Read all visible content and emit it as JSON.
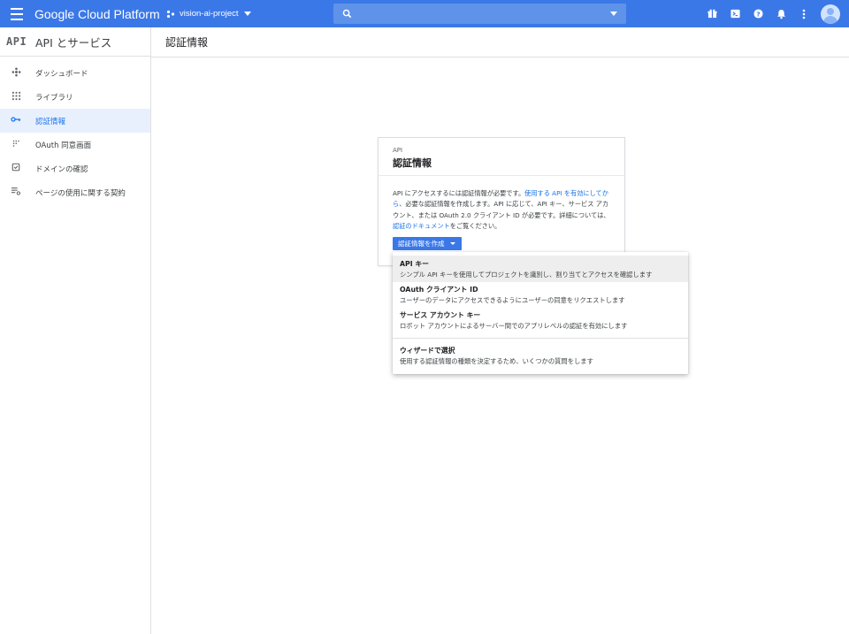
{
  "topbar": {
    "brand": "Google Cloud Platform",
    "project": "vision-ai-project",
    "search_placeholder": ""
  },
  "sidebar": {
    "header_mark": "API",
    "header_title": "API とサービス",
    "items": [
      {
        "label": "ダッシュボード",
        "icon": "dashboard-icon"
      },
      {
        "label": "ライブラリ",
        "icon": "library-icon"
      },
      {
        "label": "認証情報",
        "icon": "key-icon",
        "active": true
      },
      {
        "label": "OAuth 同意画面",
        "icon": "oauth-consent-icon"
      },
      {
        "label": "ドメインの確認",
        "icon": "domain-verification-icon"
      },
      {
        "label": "ページの使用に関する契約",
        "icon": "page-usage-agreement-icon"
      }
    ]
  },
  "main": {
    "title": "認証情報"
  },
  "card": {
    "label": "API",
    "title": "認証情報",
    "desc_1": "API にアクセスするには認証情報が必要です。",
    "link_1": "使用する API を有効にしてから",
    "desc_2": "、必要な認証情報を作成します。API に応じて、API キー、サービス アカウント、または OAuth 2.0 クライアント ID が必要です。詳細については、",
    "link_2": "認証のドキュメント",
    "desc_3": "をご覧ください。",
    "create_button": "認証情報を作成"
  },
  "dropdown": {
    "items": [
      {
        "title": "API キー",
        "desc": "シンプル API キーを使用してプロジェクトを識別し、割り当てとアクセスを確認します"
      },
      {
        "title": "OAuth クライアント ID",
        "desc": "ユーザーのデータにアクセスできるようにユーザーの同意をリクエストします"
      },
      {
        "title": "サービス アカウント キー",
        "desc": "ロボット アカウントによるサーバー間でのアプリレベルの認証を有効にします"
      },
      {
        "title": "ウィザードで選択",
        "desc": "使用する認証情報の種類を決定するため、いくつかの質問をします"
      }
    ]
  },
  "colors": {
    "topbar": "#3b78e7",
    "accent": "#1a73e8",
    "active_bg": "#e8f0fe"
  }
}
